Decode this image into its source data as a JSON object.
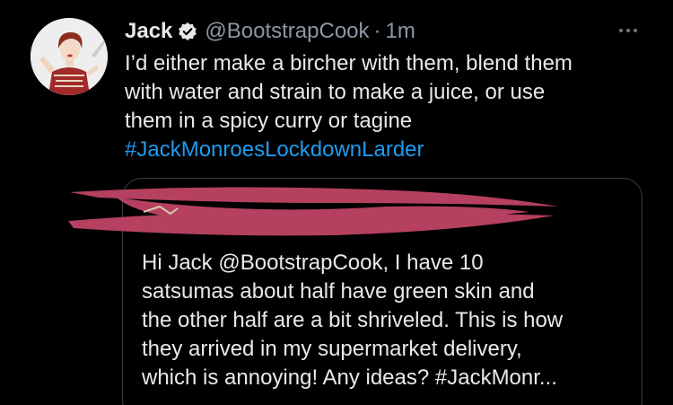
{
  "tweet": {
    "author": {
      "display_name": "Jack",
      "handle": "@BootstrapCook",
      "verified_icon": "verified-badge-icon",
      "avatar_icon": "profile-photo"
    },
    "separator": "·",
    "timestamp": "1m",
    "more_icon": "more-options-icon",
    "body_lines": [
      "I’d either make a bircher with them, blend them",
      "with water and strain to make a juice, or use",
      "them in a spicy curry or tagine"
    ],
    "hashtag": "#JackMonroesLockdownLarder",
    "colors": {
      "background": "#000000",
      "text": "#e7e9ea",
      "secondary": "#8b98a5",
      "link": "#1d9bf0",
      "redaction": "#b5405f"
    }
  },
  "quoted_tweet": {
    "redacted_author_icon": "redacted-scribble",
    "lines": [
      "Hi Jack @BootstrapCook, I have 10",
      "satsumas about half have green skin and",
      "the other half are a bit shriveled. This is how",
      "they arrived in my supermarket delivery,",
      "which is annoying! Any ideas? #JackMonr..."
    ]
  }
}
